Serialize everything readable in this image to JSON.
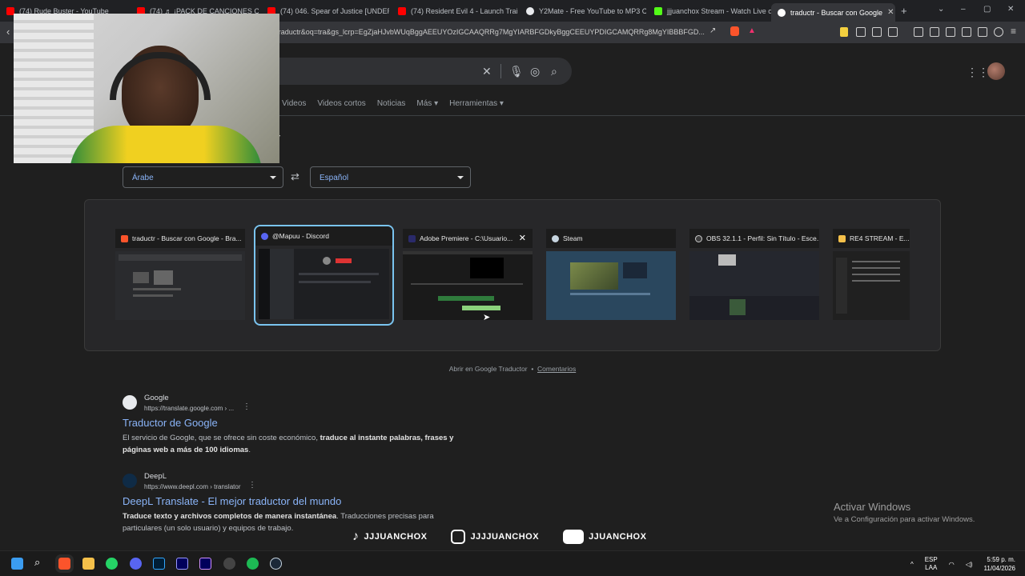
{
  "browser": {
    "tabs": [
      {
        "label": "(74) Rude Buster - YouTube",
        "color": "#ff0000"
      },
      {
        "label": "(74) ♬ ¡PACK DE CANCIONES C",
        "color": "#ff0000"
      },
      {
        "label": "(74) 046. Spear of Justice [UNDERTA",
        "color": "#ff0000"
      },
      {
        "label": "(74) Resident Evil 4 - Launch Trailer",
        "color": "#ff0000"
      },
      {
        "label": "Y2Mate - Free YouTube to MP3 Co",
        "color": "#e8eaed"
      },
      {
        "label": "jjjuanchox Stream - Watch Live on K",
        "color": "#53fc18"
      },
      {
        "label": "traductr - Buscar con Google",
        "color": "#ffffff"
      }
    ],
    "url": "=traductr&oq=tra&gs_lcrp=EgZjaHJvbWUqBggAEEUYOzIGCAAQRRg7MgYIARBFGDkyBggCEEUYPDIGCAMQRRg8MgYIBBBFGD..."
  },
  "search": {
    "tabs": [
      "Videos",
      "Videos cortos",
      "Noticias",
      "Más",
      "Herramientas"
    ],
    "partial_heading": "r"
  },
  "translator": {
    "source_lang": "Árabe",
    "target_lang": "Español",
    "open_link": "Abrir en Google Traductor",
    "separator": "•",
    "feedback": "Comentarios"
  },
  "switcher": {
    "windows": [
      {
        "title": "traductr - Buscar con Google - Bra...",
        "icon_color": "#fb542b",
        "thumb": "#2a2b2e"
      },
      {
        "title": "@Mapuu - Discord",
        "icon_color": "#5865f2",
        "thumb": "#1e1f22"
      },
      {
        "title": "Adobe Premiere - C:\\Usuario...",
        "icon_color": "#2a2a6a",
        "thumb": "#1a1a1a"
      },
      {
        "title": "Steam",
        "icon_color": "#1b2838",
        "thumb": "#2a475e"
      },
      {
        "title": "OBS 32.1.1 - Perfil: Sin Título - Esce...",
        "icon_color": "#3c3c3c",
        "thumb": "#25272e"
      },
      {
        "title": "RE4 STREAM - E...",
        "icon_color": "#f5c04a",
        "thumb": "#202020"
      }
    ]
  },
  "results": [
    {
      "site": "Google",
      "url": "https://translate.google.com › ...",
      "title": "Traductor de Google",
      "snippet_plain": "El servicio de Google, que se ofrece sin coste económico, ",
      "snippet_bold": "traduce al instante palabras, frases y páginas web a más de 100 idiomas",
      "snippet_tail": "."
    },
    {
      "site": "DeepL",
      "url": "https://www.deepl.com › translator",
      "title": "DeepL Translate - El mejor traductor del mundo",
      "snippet_bold": "Traduce texto y archivos completos de manera instantánea",
      "snippet_plain": ". Traducciones precisas para particulares (un solo usuario) y equipos de trabajo."
    }
  ],
  "watermark": {
    "title": "Activar Windows",
    "subtitle": "Ve a Configuración para activar Windows."
  },
  "overlay_socials": [
    "JJJUANCHOX",
    "JJJJUANCHOX",
    "JJUANCHOX"
  ],
  "taskbar": {
    "lang": "ESP",
    "layout": "LAA",
    "time": "5:59 p. m.",
    "date": "11/04/2026"
  }
}
